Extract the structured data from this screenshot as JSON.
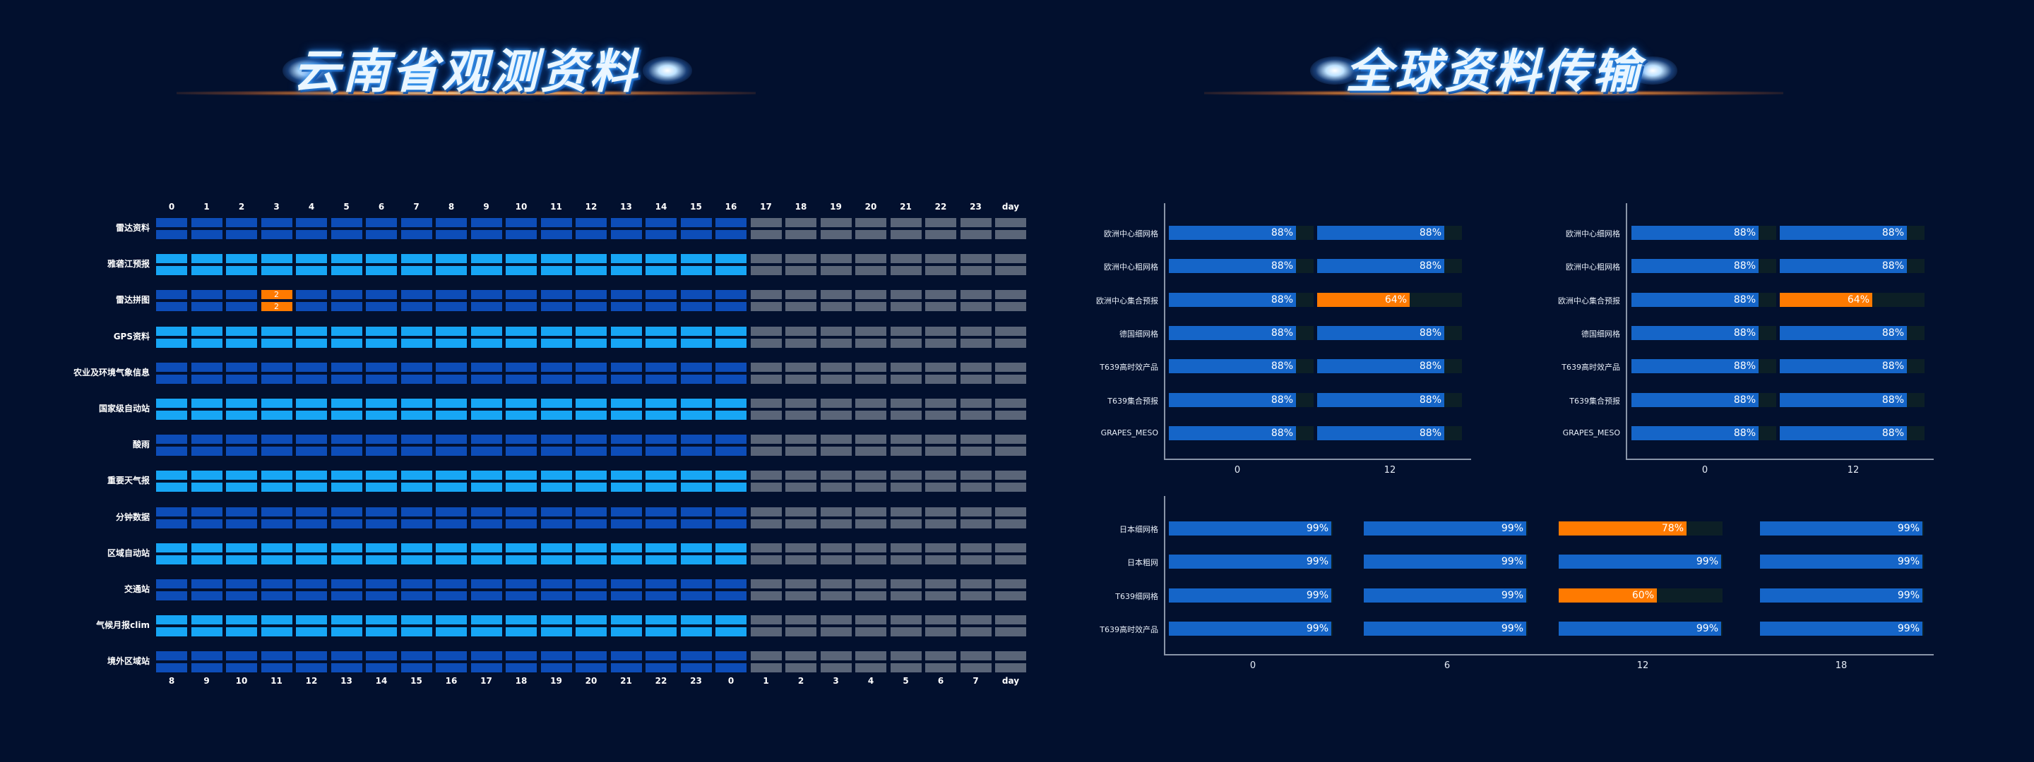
{
  "titles": {
    "left": "云南省观测资料",
    "right": "全球资料传输"
  },
  "colors": {
    "background": "#02102e",
    "dark_blue": "#0d4db8",
    "light_blue": "#17a6f5",
    "gray": "#5a6578",
    "orange": "#ff7a00",
    "bar_blue": "#1565c8",
    "bar_track": "#0c1f26"
  },
  "chart_data": [
    {
      "type": "heatmap",
      "top_columns": [
        "0",
        "1",
        "2",
        "3",
        "4",
        "5",
        "6",
        "7",
        "8",
        "9",
        "10",
        "11",
        "12",
        "13",
        "14",
        "15",
        "16",
        "17",
        "18",
        "19",
        "20",
        "21",
        "22",
        "23",
        "day"
      ],
      "bottom_columns": [
        "8",
        "9",
        "10",
        "11",
        "12",
        "13",
        "14",
        "15",
        "16",
        "17",
        "18",
        "19",
        "20",
        "21",
        "22",
        "23",
        "0",
        "1",
        "2",
        "3",
        "4",
        "5",
        "6",
        "7",
        "day"
      ],
      "rows": [
        "雷达资料",
        "雅砻江预报",
        "雷达拼图",
        "GPS资料",
        "农业及环境气象信息",
        "国家级自动站",
        "酸雨",
        "重要天气报",
        "分钟数据",
        "区域自动站",
        "交通站",
        "气候月报clim",
        "境外区域站"
      ],
      "row_styles": [
        "dark",
        "light",
        "dark",
        "light",
        "dark",
        "light",
        "dark",
        "light",
        "dark",
        "light",
        "dark",
        "light",
        "dark"
      ],
      "received_columns": 17,
      "alerts": [
        {
          "row": 2,
          "column": "3",
          "top_value": "2",
          "bottom_value": "2"
        }
      ]
    },
    {
      "type": "bar",
      "orientation": "horizontal",
      "categories": [
        "欧洲中心细网格",
        "欧洲中心粗网格",
        "欧洲中心集合预报",
        "德国细网格",
        "T639高时效产品",
        "T639集合预报",
        "GRAPES_MESO"
      ],
      "x_ticks": [
        "0",
        "12"
      ],
      "series": [
        {
          "values": [
            88,
            88,
            88,
            88,
            88,
            88,
            88
          ]
        },
        {
          "values": [
            88,
            88,
            64,
            88,
            88,
            88,
            88
          ]
        }
      ]
    },
    {
      "type": "bar",
      "orientation": "horizontal",
      "categories": [
        "欧洲中心细网格",
        "欧洲中心粗网格",
        "欧洲中心集合预报",
        "德国细网格",
        "T639高时效产品",
        "T639集合预报",
        "GRAPES_MESO"
      ],
      "x_ticks": [
        "0",
        "12"
      ],
      "series": [
        {
          "values": [
            88,
            88,
            88,
            88,
            88,
            88,
            88
          ]
        },
        {
          "values": [
            88,
            88,
            64,
            88,
            88,
            88,
            88
          ]
        }
      ]
    },
    {
      "type": "bar",
      "orientation": "horizontal",
      "categories": [
        "日本细网格",
        "日本粗网",
        "T639细网格",
        "T639高时效产品"
      ],
      "x_ticks": [
        "0",
        "6",
        "12",
        "18"
      ],
      "series": [
        {
          "values": [
            99,
            99,
            99,
            99
          ]
        },
        {
          "values": [
            99,
            99,
            99,
            99
          ]
        },
        {
          "values": [
            78,
            99,
            60,
            99
          ]
        },
        {
          "values": [
            99,
            99,
            99,
            99
          ]
        }
      ]
    }
  ]
}
